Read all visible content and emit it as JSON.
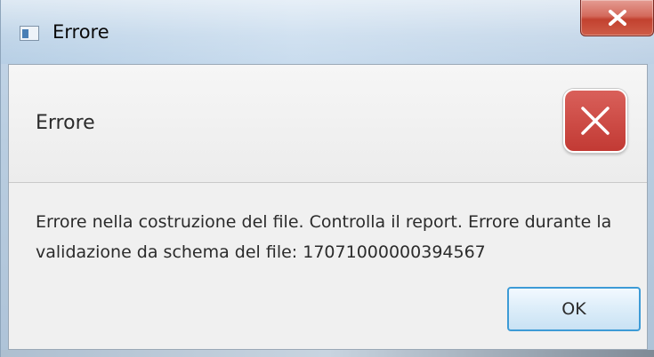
{
  "window": {
    "title": "Errore",
    "icon": "window-app-icon",
    "close_icon": "close-icon"
  },
  "dialog": {
    "header": "Errore",
    "header_icon": "error-x-icon",
    "message": "Errore nella costruzione del file. Controlla il report. Errore durante la validazione da schema del file: 17071000000394567",
    "ok_label": "OK"
  },
  "colors": {
    "error_icon": "#c9423c",
    "ok_border": "#3d9bd6",
    "close_button": "#c2412f"
  }
}
